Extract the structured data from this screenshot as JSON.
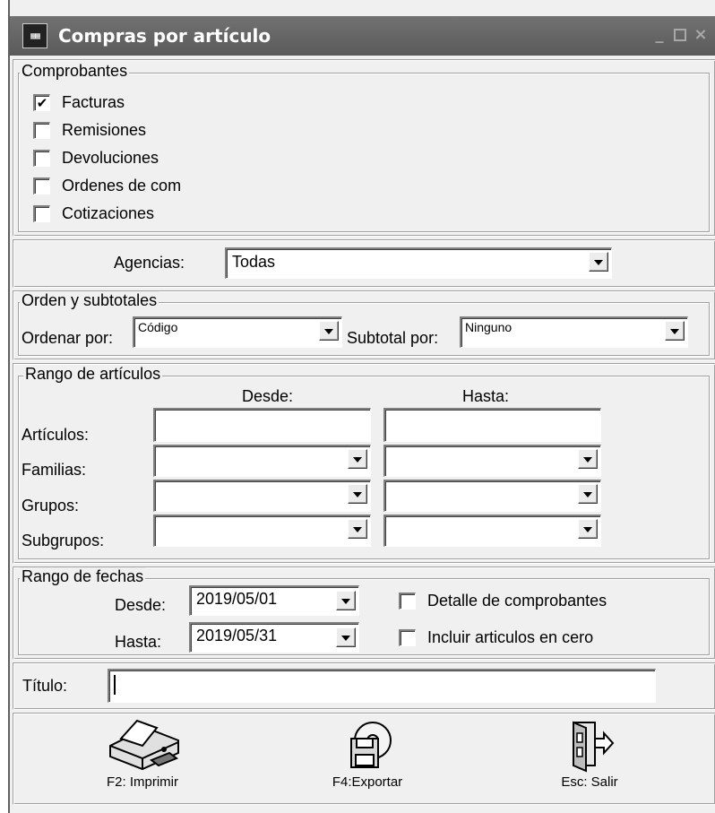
{
  "window": {
    "title": "Compras por artículo",
    "minimize_icon": "minimize-icon",
    "maximize_icon": "maximize-icon",
    "close_icon": "close-icon"
  },
  "comprobantes": {
    "legend": "Comprobantes",
    "items": [
      {
        "label": "Facturas",
        "checked": true
      },
      {
        "label": "Remisiones",
        "checked": false
      },
      {
        "label": "Devoluciones",
        "checked": false
      },
      {
        "label": "Ordenes de com",
        "checked": false
      },
      {
        "label": "Cotizaciones",
        "checked": false
      }
    ]
  },
  "agencias": {
    "label": "Agencias:",
    "value": "Todas"
  },
  "orden": {
    "legend": "Orden y subtotales",
    "ordenar_label": "Ordenar por:",
    "ordenar_value": "Código",
    "subtotal_label": "Subtotal por:",
    "subtotal_value": "Ninguno"
  },
  "rango_articulos": {
    "legend": "Rango de artículos",
    "desde_header": "Desde:",
    "hasta_header": "Hasta:",
    "rows": [
      "Artículos:",
      "Familias:",
      "Grupos:",
      "Subgrupos:"
    ]
  },
  "rango_fechas": {
    "legend": "Rango de fechas",
    "desde_label": "Desde:",
    "desde_value": "2019/05/01",
    "hasta_label": "Hasta:",
    "hasta_value": "2019/05/31",
    "detalle_label": "Detalle de comprobantes",
    "detalle_checked": false,
    "incluir_label": "Incluir articulos en cero",
    "incluir_checked": false
  },
  "titulo": {
    "label": "Título:",
    "value": ""
  },
  "toolbar": {
    "imprimir_label": "F2: Imprimir",
    "exportar_label": "F4:Exportar",
    "salir_label": "Esc: Salir"
  }
}
